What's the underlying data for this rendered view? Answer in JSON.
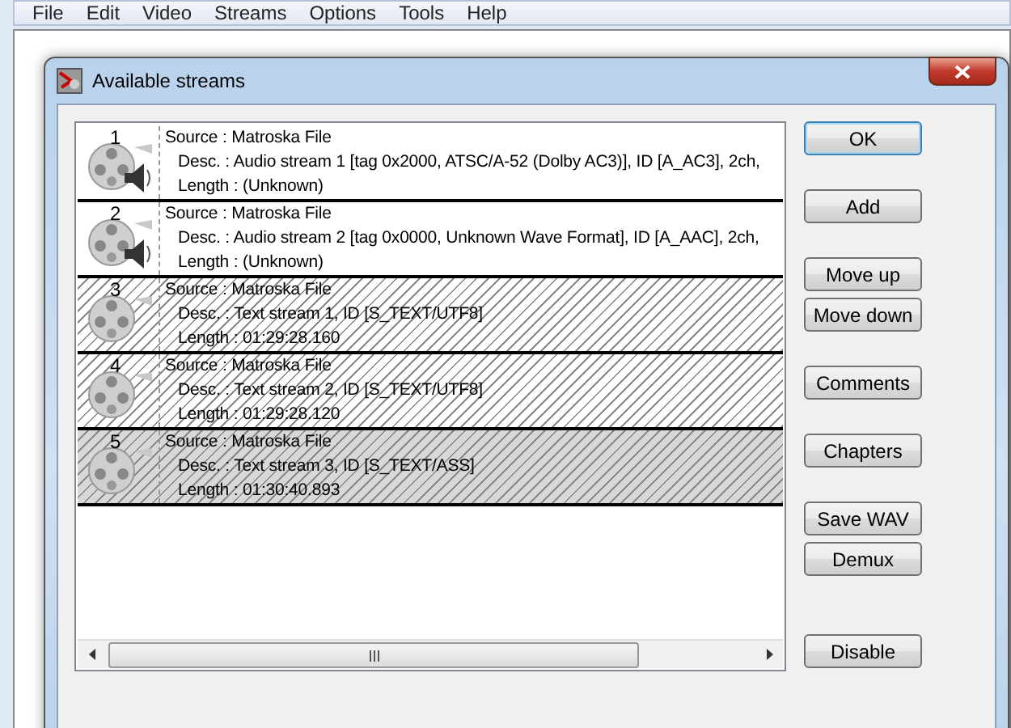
{
  "menu": [
    "File",
    "Edit",
    "Video",
    "Streams",
    "Options",
    "Tools",
    "Help"
  ],
  "dialog": {
    "title": "Available streams",
    "streams": [
      {
        "number": "1",
        "kind": "audio",
        "disabled": false,
        "selected": false,
        "source": "Source : Matroska File",
        "desc": "Desc. : Audio stream 1 [tag 0x2000, ATSC/A-52 (Dolby AC3)], ID [A_AC3], 2ch,",
        "length": "Length : (Unknown)"
      },
      {
        "number": "2",
        "kind": "audio",
        "disabled": false,
        "selected": false,
        "source": "Source : Matroska File",
        "desc": "Desc. : Audio stream 2 [tag 0x0000, Unknown Wave Format], ID [A_AAC], 2ch,",
        "length": "Length : (Unknown)"
      },
      {
        "number": "3",
        "kind": "text",
        "disabled": true,
        "selected": false,
        "source": "Source : Matroska File",
        "desc": "Desc. : Text stream 1, ID [S_TEXT/UTF8]",
        "length": "Length : 01:29:28.160"
      },
      {
        "number": "4",
        "kind": "text",
        "disabled": true,
        "selected": false,
        "source": "Source : Matroska File",
        "desc": "Desc. : Text stream 2, ID [S_TEXT/UTF8]",
        "length": "Length : 01:29:28.120"
      },
      {
        "number": "5",
        "kind": "text",
        "disabled": true,
        "selected": true,
        "source": "Source : Matroska File",
        "desc": "Desc. : Text stream 3, ID [S_TEXT/ASS]",
        "length": "Length : 01:30:40.893"
      }
    ],
    "button_groups": [
      [
        {
          "label": "OK",
          "default": true
        }
      ],
      [
        {
          "label": "Add",
          "default": false
        }
      ],
      [
        {
          "label": "Move up",
          "default": false
        },
        {
          "label": "Move down",
          "default": false
        }
      ],
      [
        {
          "label": "Comments",
          "default": false
        }
      ],
      [
        {
          "label": "Chapters",
          "default": false
        }
      ],
      [
        {
          "label": "Save WAV",
          "default": false
        },
        {
          "label": "Demux",
          "default": false
        }
      ],
      [
        {
          "label": "Disable",
          "default": false
        }
      ]
    ]
  }
}
